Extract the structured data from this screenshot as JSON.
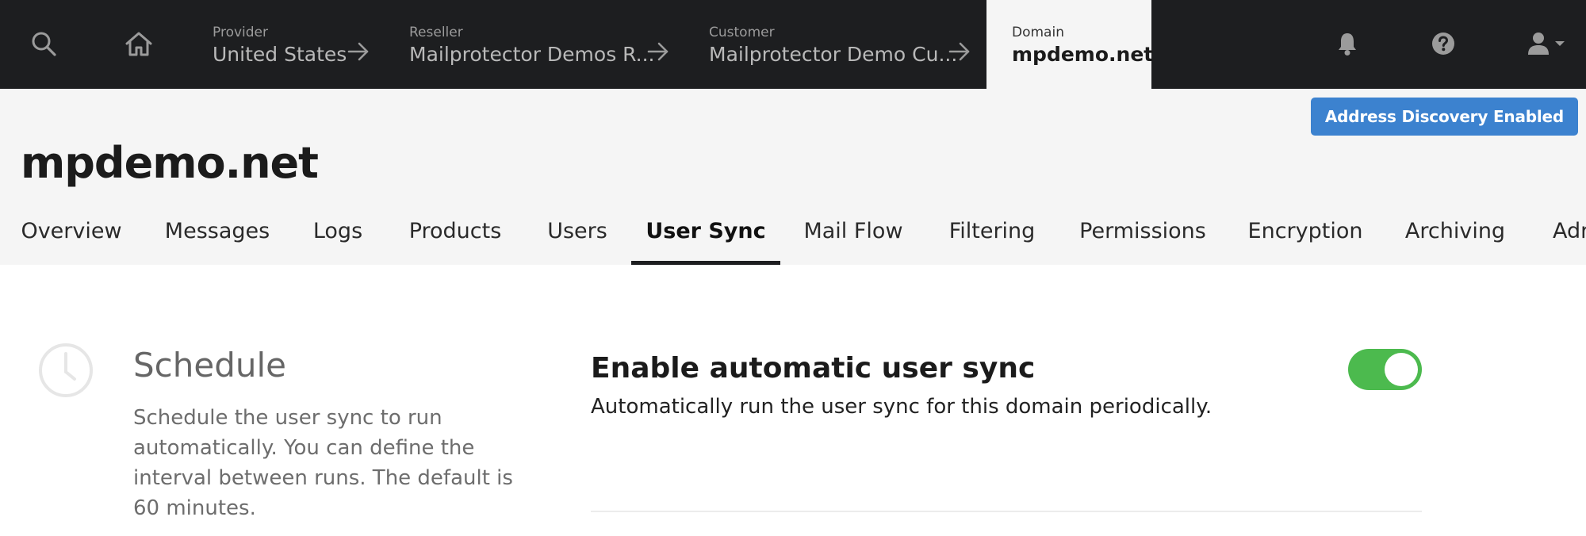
{
  "topnav": {
    "icons": [
      "search-icon",
      "home-icon",
      "bell-icon",
      "help-icon",
      "user-icon",
      "caret-down-icon"
    ],
    "breadcrumbs": [
      {
        "label": "Provider",
        "value": "United States"
      },
      {
        "label": "Reseller",
        "value": "Mailprotector Demos R..."
      },
      {
        "label": "Customer",
        "value": "Mailprotector Demo Cu..."
      },
      {
        "label": "Domain",
        "value": "mpdemo.net"
      }
    ]
  },
  "header": {
    "discovery_button": "Address Discovery Enabled",
    "title": "mpdemo.net"
  },
  "tabs": [
    {
      "label": "Overview"
    },
    {
      "label": "Messages"
    },
    {
      "label": "Logs"
    },
    {
      "label": "Products"
    },
    {
      "label": "Users"
    },
    {
      "label": "User Sync",
      "active": true
    },
    {
      "label": "Mail Flow"
    },
    {
      "label": "Filtering"
    },
    {
      "label": "Permissions"
    },
    {
      "label": "Encryption"
    },
    {
      "label": "Archiving"
    },
    {
      "label": "Adr"
    }
  ],
  "schedule": {
    "icon": "clock-icon",
    "title": "Schedule",
    "description": "Schedule the user sync to run automatically. You can define the interval between runs. The default is 60 minutes.",
    "setting_title": "Enable automatic user sync",
    "setting_description": "Automatically run the user sync for this domain periodically.",
    "toggle_on": true
  },
  "colors": {
    "nav_bg": "#1d1e20",
    "header_bg": "#f5f5f5",
    "accent_blue": "#3c82cf",
    "toggle_green": "#4cba4e"
  }
}
